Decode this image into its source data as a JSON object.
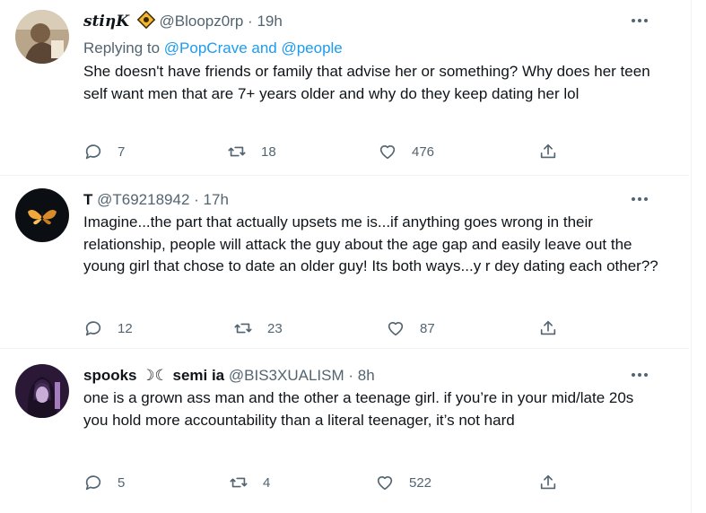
{
  "tweets": [
    {
      "author": "stiηK",
      "author_badge": "dotted-diamond-emoji",
      "handle": "@Bloopz0rp",
      "dot": "·",
      "time": "19h",
      "reply_prefix": "Replying to",
      "reply_targets": "@PopCrave and @people",
      "text": "She doesn't have friends or family that advise her or something? Why does her teen self want men that are 7+ years older and why do they keep dating her lol",
      "replies": "7",
      "retweets": "18",
      "likes": "476",
      "avatar_colors": [
        "#8c7a63",
        "#c9b79b",
        "#5a4a3b"
      ]
    },
    {
      "author": "T",
      "handle": "@T69218942",
      "dot": "·",
      "time": "17h",
      "text": "Imagine...the part that actually upsets me is...if anything goes wrong in their relationship,  people will attack the guy about the age gap and easily leave out the young girl that chose to date an older guy! Its both ways...y r dey dating each other??",
      "replies": "12",
      "retweets": "23",
      "likes": "87",
      "avatar_colors": [
        "#0d1117",
        "#f2a93b",
        "#2b3a4a"
      ]
    },
    {
      "author": "spooks",
      "author_symbol": "☽☾",
      "author_suffix": "semi ia",
      "handle": "@BIS3XUALISM",
      "dot": "·",
      "time": "8h",
      "text": "one is a grown ass man and the other a teenage girl. if you’re in your mid/late 20s you hold more accountability than a literal teenager, it’s not hard",
      "replies": "5",
      "retweets": "4",
      "likes": "522",
      "avatar_colors": [
        "#4a2c5e",
        "#a37bbf",
        "#1b1024"
      ]
    }
  ],
  "colors": {
    "link": "#1d9bf0",
    "muted": "#536471",
    "text": "#0f1419"
  }
}
